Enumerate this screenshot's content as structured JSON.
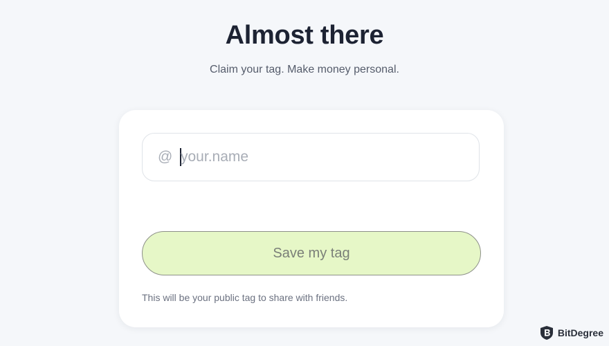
{
  "header": {
    "title": "Almost there",
    "subtitle": "Claim your tag. Make money personal."
  },
  "form": {
    "prefix": "@",
    "tag_input": {
      "value": "",
      "placeholder": "your.name"
    },
    "save_label": "Save my tag",
    "helper_text": "This will be your public tag to share with friends."
  },
  "watermark": {
    "brand": "BitDegree",
    "icon": "bitdegree-shield-icon"
  },
  "colors": {
    "background": "#f5f7fa",
    "card": "#ffffff",
    "button_fill": "#e6f7c7",
    "title": "#1d2333"
  }
}
